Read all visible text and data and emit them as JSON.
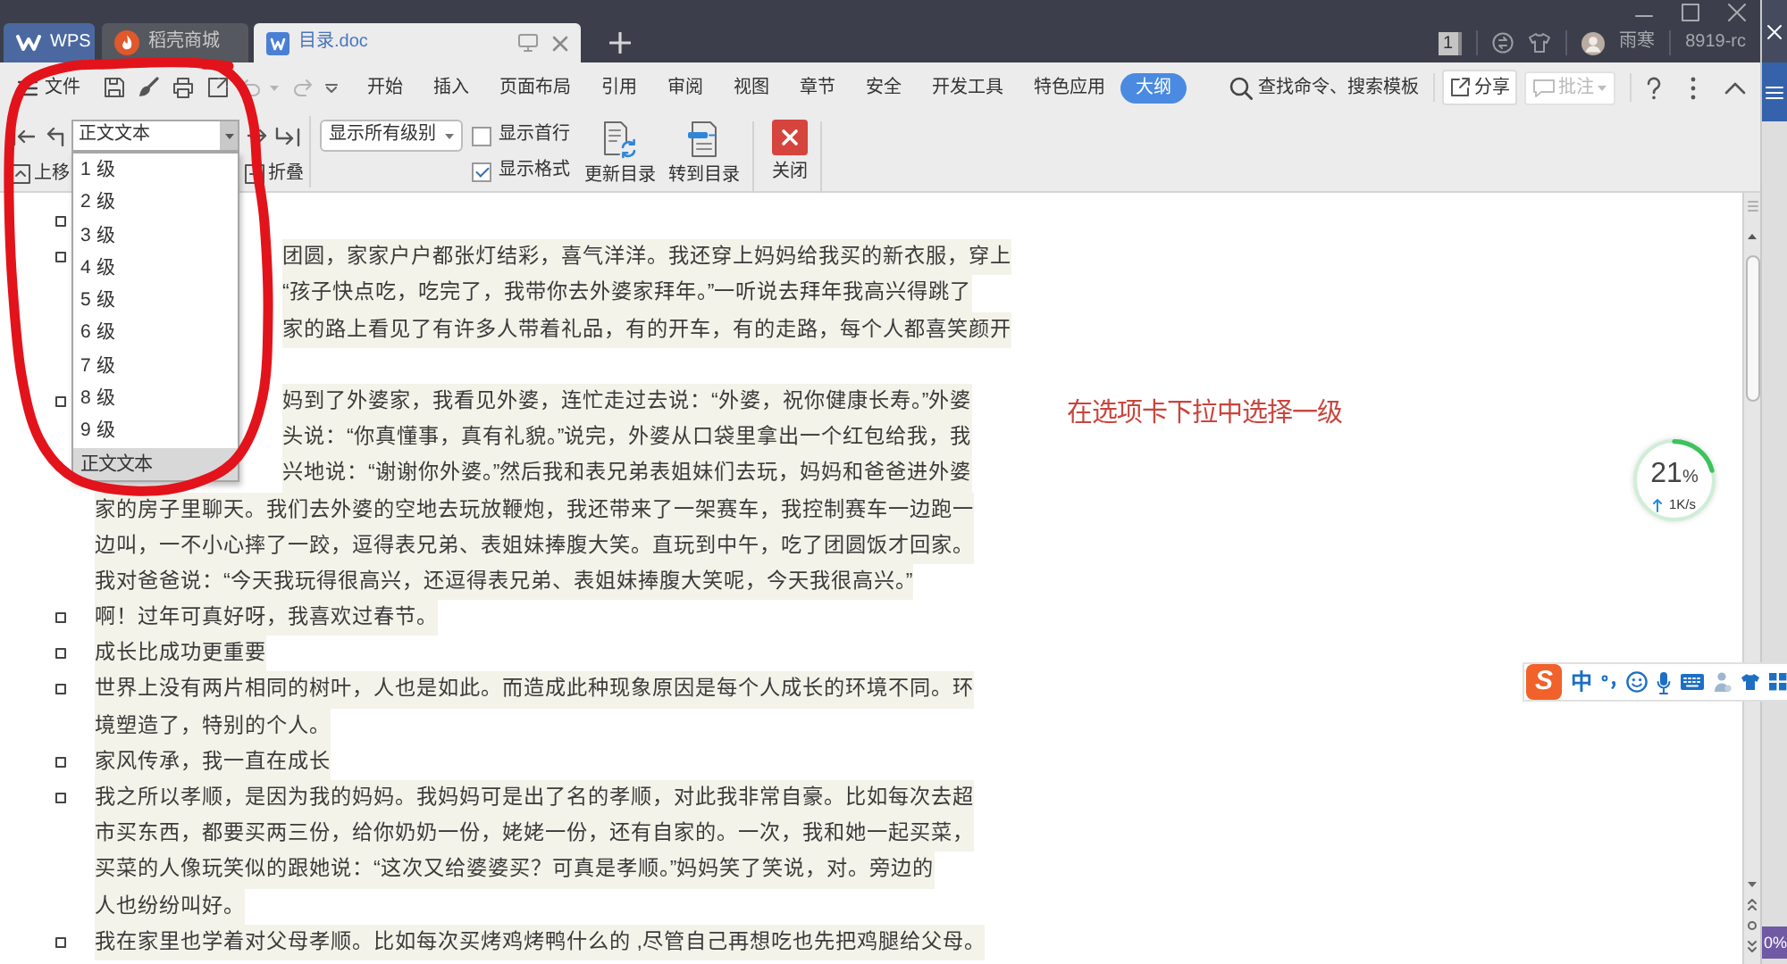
{
  "title_bar": {
    "tabs": [
      {
        "kind": "home",
        "label": "WPS",
        "selected": false
      },
      {
        "kind": "store",
        "label": "稻壳商城",
        "selected": false
      },
      {
        "kind": "document",
        "label": "目录.doc",
        "selected": true
      }
    ],
    "window_count": "1",
    "user_name": "雨寒",
    "account": "8919-rc"
  },
  "menu_bar": {
    "file_label": "文件",
    "quick_access": [
      {
        "kind": "save",
        "disabled": false
      },
      {
        "kind": "format_painter",
        "disabled": false
      },
      {
        "kind": "print",
        "disabled": false
      },
      {
        "kind": "export",
        "disabled": false
      },
      {
        "kind": "undo",
        "disabled": true
      },
      {
        "kind": "redo",
        "disabled": true
      }
    ],
    "ribbon_tabs": [
      {
        "label": "开始",
        "selected": false
      },
      {
        "label": "插入",
        "selected": false
      },
      {
        "label": "页面布局",
        "selected": false
      },
      {
        "label": "引用",
        "selected": false
      },
      {
        "label": "审阅",
        "selected": false
      },
      {
        "label": "视图",
        "selected": false
      },
      {
        "label": "章节",
        "selected": false
      },
      {
        "label": "安全",
        "selected": false
      },
      {
        "label": "开发工具",
        "selected": false
      },
      {
        "label": "特色应用",
        "selected": false
      },
      {
        "label": "大纲",
        "selected": true
      }
    ],
    "search_label": "查找命令、搜索模板",
    "share_label": "分享",
    "comment": {
      "label": "批注",
      "disabled": true
    }
  },
  "outline_toolbar": {
    "level_combo": {
      "value": "正文文本",
      "expanded": true,
      "options": [
        {
          "label": "1 级",
          "selected": false
        },
        {
          "label": "2 级",
          "selected": false
        },
        {
          "label": "3 级",
          "selected": false
        },
        {
          "label": "4 级",
          "selected": false
        },
        {
          "label": "5 级",
          "selected": false
        },
        {
          "label": "6 级",
          "selected": false
        },
        {
          "label": "7 级",
          "selected": false
        },
        {
          "label": "8 级",
          "selected": false
        },
        {
          "label": "9 级",
          "selected": false
        },
        {
          "label": "正文文本",
          "selected": true
        }
      ]
    },
    "move_up_label": "上移",
    "collapse_label": "折叠",
    "level_filter": {
      "value": "显示所有级别"
    },
    "checkboxes": [
      {
        "label": "显示首行",
        "checked": false
      },
      {
        "label": "显示格式",
        "checked": true
      }
    ],
    "actions": [
      {
        "kind": "update",
        "label": "更新目录"
      },
      {
        "kind": "goto",
        "label": "转到目录"
      },
      {
        "kind": "close",
        "label": "关闭"
      }
    ]
  },
  "document": {
    "paragraphs": [
      {
        "kind": "body"
      },
      {
        "kind": "body",
        "lines": [
          "团圆，家家户户都张灯结彩，喜气洋洋。我还穿上妈妈给我买的新衣服，穿上",
          "“孩子快点吃，吃完了，我带你去外婆家拜年。”一听说去拜年我高兴得跳了",
          "家的路上看见了有许多人带着礼品，有的开车，有的走路，每个人都喜笑颜开"
        ]
      },
      {
        "kind": "body",
        "lines": [
          "妈到了外婆家，我看见外婆，连忙走过去说：“外婆，祝你健康长寿。”外婆",
          "头说：“你真懂事，真有礼貌。”说完，外婆从口袋里拿出一个红包给我，我",
          "兴地说：“谢谢你外婆。”然后我和表兄弟表姐妹们去玩，妈妈和爸爸进外婆",
          "家的房子里聊天。我们去外婆的空地去玩放鞭炮，我还带来了一架赛车，我控制赛车一边跑一",
          "边叫，一不小心摔了一跤，逗得表兄弟、表姐妹捧腹大笑。直玩到中午，吃了团圆饭才回家。",
          "我对爸爸说：“今天我玩得很高兴，还逗得表兄弟、表姐妹捧腹大笑呢，今天我很高兴。”"
        ]
      },
      {
        "kind": "body",
        "lines": [
          "啊！过年可真好呀，我喜欢过春节。"
        ]
      },
      {
        "kind": "body",
        "lines": [
          "成长比成功更重要"
        ]
      },
      {
        "kind": "body",
        "lines": [
          "世界上没有两片相同的树叶，人也是如此。而造成此种现象原因是每个人成长的环境不同。环",
          "境塑造了，特别的个人。"
        ]
      },
      {
        "kind": "body",
        "lines": [
          "家风传承，我一直在成长"
        ]
      },
      {
        "kind": "body",
        "lines": [
          "我之所以孝顺，是因为我的妈妈。我妈妈可是出了名的孝顺，对此我非常自豪。比如每次去超",
          "市买东西，都要买两三份，给你奶奶一份，姥姥一份，还有自家的。一次，我和她一起买菜，",
          "买菜的人像玩笑似的跟她说：“这次又给婆婆买？可真是孝顺。”妈妈笑了笑说，对。旁边的",
          "人也纷纷叫好。"
        ]
      },
      {
        "kind": "body",
        "lines": [
          "我在家里也学着对父母孝顺。比如每次买烤鸡烤鸭什么的 ,尽管自己再想吃也先把鸡腿给父母。"
        ]
      }
    ]
  },
  "annotation": {
    "text": "在选项卡下拉中选择一级"
  },
  "network_meter": {
    "value": "21",
    "unit": "%",
    "speed": "1K/s"
  },
  "ime_bar": {
    "logo": "S",
    "mode": "中"
  },
  "background_window": {
    "zoom_label": "0%"
  }
}
